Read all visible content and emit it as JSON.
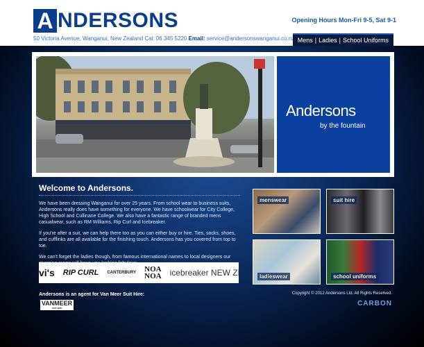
{
  "header": {
    "logo_initial": "A",
    "logo_rest": "NDERSONS",
    "address": "50 Victoria Avenue, Wanganui, New Zealand Cal: 06 345 5220",
    "email_label": "Email:",
    "email": "service@andersonswanganui.co.nz",
    "hours": "Opening Hours Mon-Fri 9-5, Sat 9-1"
  },
  "nav": {
    "items": [
      {
        "label": "Mens"
      },
      {
        "label": "Ladies"
      },
      {
        "label": "School Uniforms"
      }
    ],
    "separator": "|"
  },
  "hero": {
    "brand_name": "Andersons",
    "brand_sub": "by the fountain"
  },
  "welcome": {
    "title": "Welcome to Andersons.",
    "paragraphs": [
      "We have been dressing Wanganui for over 25 years. From school wear to business suits, Andersons really does have something for everyone. We have schoolwear for City College, High School and Cullinane College. We also have a fantastic range of branded mens casualwear, such as RM Williams, Rip Curl and Icebreaker.",
      "If you're after a suit, we can help there too as you can either buy or hire. Ties, socks, shoes, and cufflinks are all available for the finishing touch. Andersons has you covered from top to toe.",
      "We can't forget the ladies though, from famous international names to local designers our stunning range will have you looking fabulous."
    ]
  },
  "brands": [
    "vi's",
    "RIP CURL",
    "CANTERBURY",
    "NOA NOA",
    "icebreaker NEW ZEALAND"
  ],
  "agent": {
    "text": "Andersons is an agent for Van Meer Suit Hire:",
    "logo": "VANMEER",
    "logo_sub": "SUIT HIRE"
  },
  "tiles": [
    {
      "label": "menswear",
      "pos": "top"
    },
    {
      "label": "suit hire",
      "pos": "top"
    },
    {
      "label": "ladieswear",
      "pos": "bottom"
    },
    {
      "label": "school uniforms",
      "pos": "bottom"
    }
  ],
  "footer": {
    "copyright": "Copyright © 2012 Andersons Ltd. All Rights Reserved.",
    "carbon": "CARBON"
  },
  "colors": {
    "brand_blue": "#0a3d8f",
    "nav_bg": "#0b1a38"
  }
}
